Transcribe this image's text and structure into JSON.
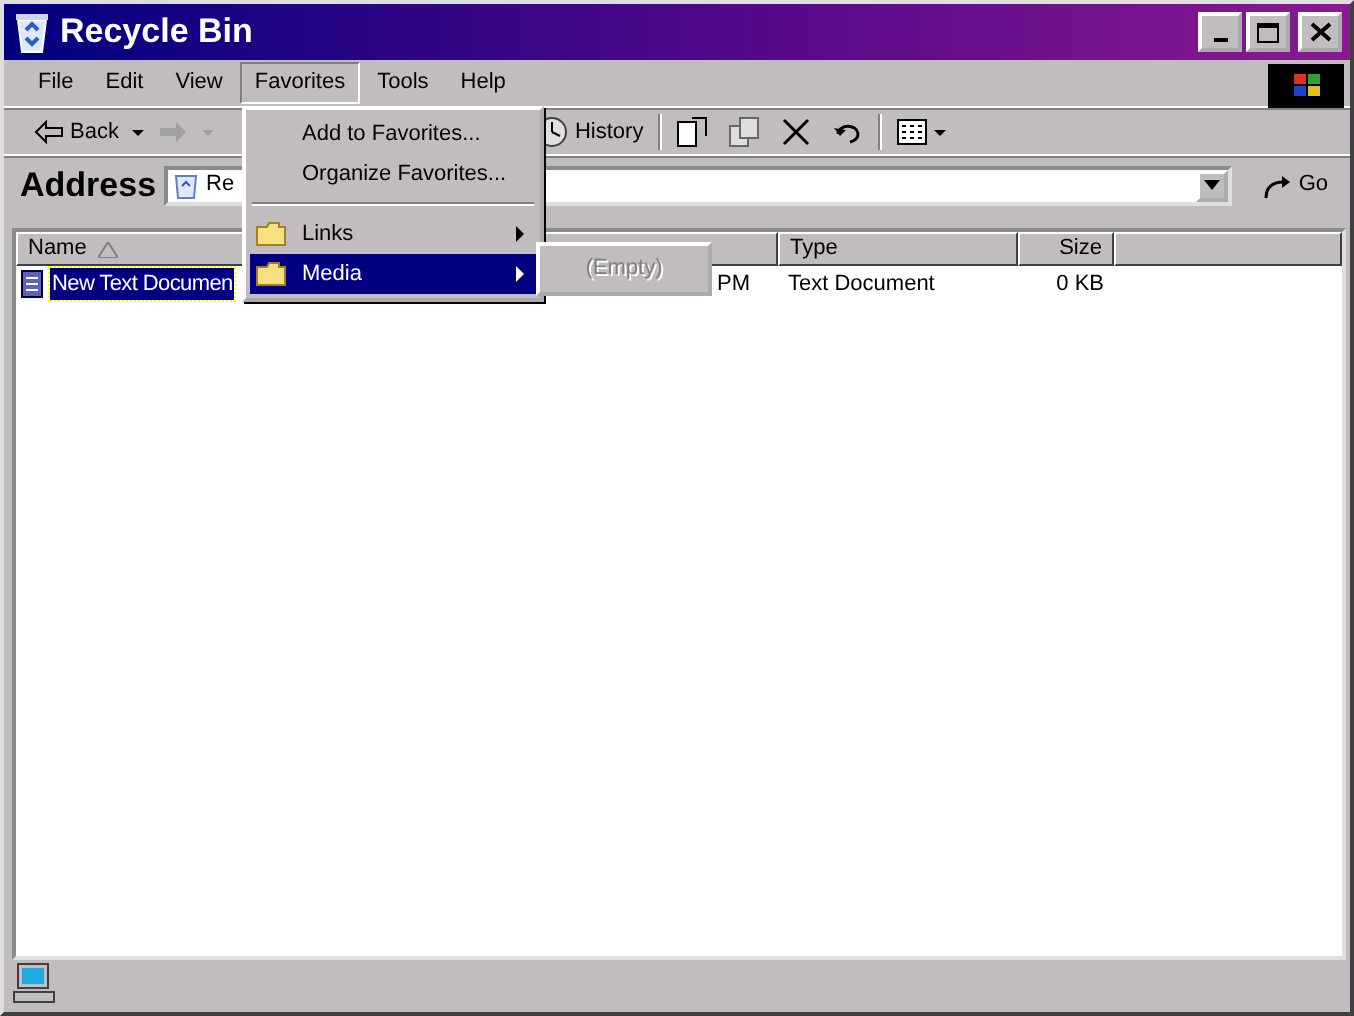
{
  "window": {
    "title": "Recycle Bin"
  },
  "menu_bar": [
    {
      "label": "File",
      "selected": false
    },
    {
      "label": "Edit",
      "selected": false
    },
    {
      "label": "View",
      "selected": false
    },
    {
      "label": "Favorites",
      "selected": true
    },
    {
      "label": "Tools",
      "selected": false
    },
    {
      "label": "Help",
      "selected": false
    }
  ],
  "toolbar": {
    "back": {
      "label": "Back"
    },
    "forward": {
      "disabled": true
    },
    "history": {
      "label": "History"
    }
  },
  "address": {
    "label": "Address",
    "value": "Re"
  },
  "go_button": {
    "label": "Go"
  },
  "columns": [
    {
      "label": "Name",
      "sorted": true
    },
    {},
    {
      "label": "Type"
    },
    {
      "label": "Size"
    }
  ],
  "rows": [
    {
      "cells": [
        "New Text Documen",
        "PM",
        "Text Document",
        "0 KB"
      ],
      "selected": true
    }
  ],
  "favorites_menu": {
    "items": [
      {
        "kind": "item",
        "label": "Add to Favorites...",
        "selected": false
      },
      {
        "kind": "item",
        "label": "Organize Favorites...",
        "selected": false
      },
      {
        "kind": "separator"
      },
      {
        "kind": "folder",
        "label": "Links",
        "selected": false
      },
      {
        "kind": "folder",
        "label": "Media",
        "selected": true
      }
    ]
  },
  "submenu": {
    "items": [
      {
        "label": "(Empty)",
        "disabled": true
      }
    ]
  }
}
